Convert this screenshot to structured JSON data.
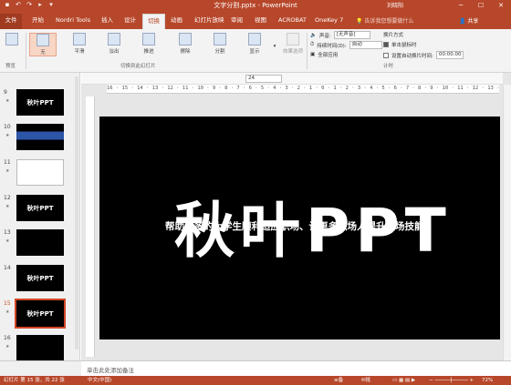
{
  "titlebar": {
    "qat_icons": [
      "save-icon",
      "undo-icon",
      "redo-icon",
      "start-icon",
      "dropdown-icon"
    ],
    "doc_title": "文字分割.pptx - PowerPoint",
    "user": "刘晓阳",
    "win_buttons": [
      "─",
      "☐",
      "✕"
    ]
  },
  "tabs": [
    {
      "label": "文件"
    },
    {
      "label": "开始"
    },
    {
      "label": "Nordri Tools"
    },
    {
      "label": "插入"
    },
    {
      "label": "设计"
    },
    {
      "label": "切换"
    },
    {
      "label": "动画"
    },
    {
      "label": "幻灯片放映"
    },
    {
      "label": "审阅"
    },
    {
      "label": "视图"
    },
    {
      "label": "ACROBAT"
    },
    {
      "label": "OneKey 7"
    }
  ],
  "active_tab": "切换",
  "tellme": "告诉我您想要做什么",
  "share": "共享",
  "ribbon": {
    "preview_label": "预览",
    "transitions": [
      "无",
      "平滑",
      "淡出",
      "推进",
      "擦除",
      "分割",
      "显示"
    ],
    "effect_options": "效果选项",
    "group_transitions": "切换到此幻灯片",
    "sound_label": "声音:",
    "sound_value": "[无声音]",
    "duration_label": "持续时间(D):",
    "duration_value": "自动",
    "apply_all": "全部应用",
    "advance_label": "换片方式",
    "on_click": "单击鼠标时",
    "after_label": "设置自动换片时间:",
    "after_value": "00:00.00",
    "group_timing": "计时"
  },
  "slides": [
    {
      "num": "9",
      "text": "秋叶PPT",
      "star": "★"
    },
    {
      "num": "10",
      "text": "",
      "star": "★"
    },
    {
      "num": "11",
      "text": "",
      "star": "★"
    },
    {
      "num": "12",
      "text": "秋叶PPT",
      "star": "★"
    },
    {
      "num": "13",
      "text": "",
      "star": "★"
    },
    {
      "num": "14",
      "text": "秋叶PPT",
      "star": ""
    },
    {
      "num": "15",
      "text": "秋叶PPT",
      "star": "★"
    },
    {
      "num": "16",
      "text": "",
      "star": "★"
    },
    {
      "num": "17",
      "text": "",
      "star": ""
    }
  ],
  "slide": {
    "title": "秋叶PPT",
    "subtitle": "帮助更多的大学生顺利适应职场、让更多职场人提升职场技能"
  },
  "ruler": "16 · 15 · 14 · 13 · 12 · 11 · 10 · 9 · 8 · 7 · 6 · 5 · 4 · 3 · 2 · 1 · 0 · 1 · 2 · 3 · 4 · 5 · 6 · 7 · 8 · 9 · 10 · 11 · 12 · 13 · 14 · 15 · 16",
  "font_size": "24",
  "notes_placeholder": "单击此处添加备注",
  "status": {
    "slide_info": "幻灯片 第 15 张，共 22 张",
    "language": "中文(中国)",
    "notes_btn": "备注",
    "comments_btn": "批注",
    "zoom": "72%"
  },
  "colors": {
    "accent": "#b7472a",
    "selected": "#d24726"
  }
}
